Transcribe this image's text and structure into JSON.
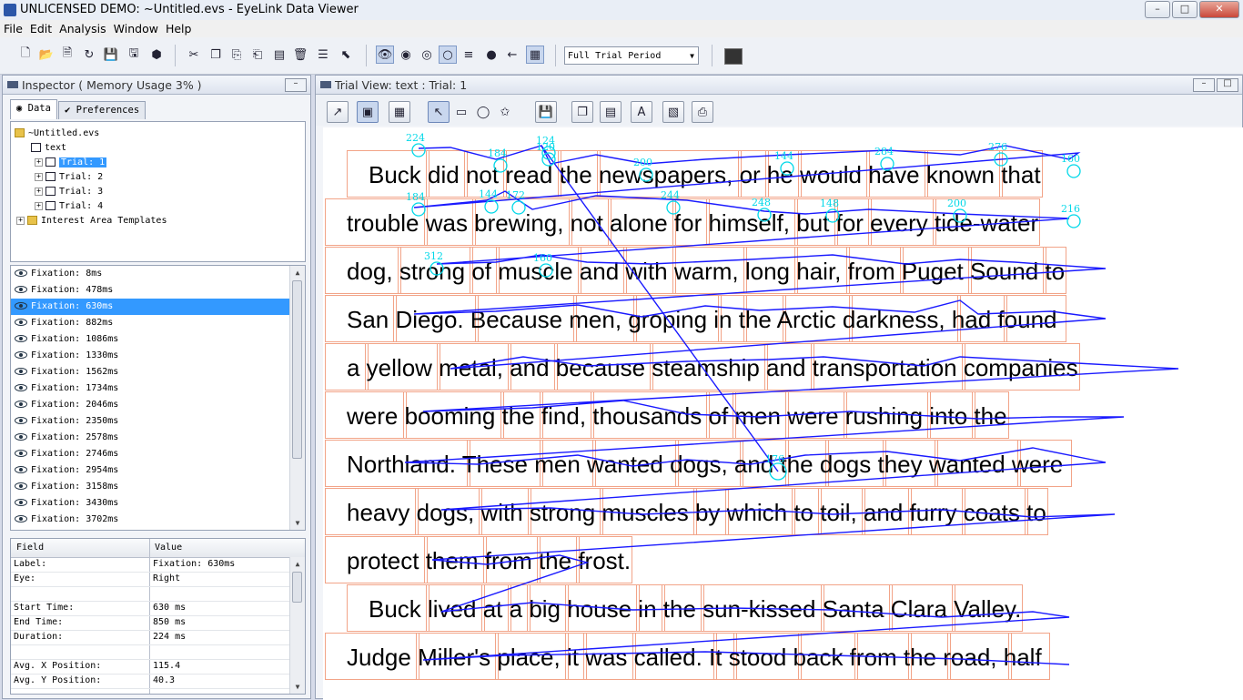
{
  "window": {
    "title": "UNLICENSED DEMO: ~Untitled.evs - EyeLink Data Viewer",
    "minimize": "–",
    "maximize": "□",
    "close": "✕"
  },
  "menu": [
    "File",
    "Edit",
    "Analysis",
    "Window",
    "Help"
  ],
  "toolbar": {
    "period_select": "Full Trial Period"
  },
  "inspector": {
    "title": "Inspector ( Memory Usage 3% )",
    "tabs": [
      "Data",
      "Preferences"
    ],
    "tree": {
      "root": "~Untitled.evs",
      "dataset": "text",
      "trials": [
        "Trial: 1",
        "Trial: 2",
        "Trial: 3",
        "Trial: 4"
      ],
      "templates": "Interest Area Templates"
    },
    "fixations": [
      "Fixation: 8ms",
      "Fixation: 478ms",
      "Fixation: 630ms",
      "Fixation: 882ms",
      "Fixation: 1086ms",
      "Fixation: 1330ms",
      "Fixation: 1562ms",
      "Fixation: 1734ms",
      "Fixation: 2046ms",
      "Fixation: 2350ms",
      "Fixation: 2578ms",
      "Fixation: 2746ms",
      "Fixation: 2954ms",
      "Fixation: 3158ms",
      "Fixation: 3430ms",
      "Fixation: 3702ms"
    ],
    "selected_fixation_index": 2,
    "properties": {
      "header_field": "Field",
      "header_value": "Value",
      "rows": [
        {
          "field": "Label:",
          "value": "Fixation: 630ms"
        },
        {
          "field": "Eye:",
          "value": "Right"
        },
        {
          "field": "",
          "value": ""
        },
        {
          "field": "Start Time:",
          "value": "630 ms"
        },
        {
          "field": "End Time:",
          "value": "850 ms"
        },
        {
          "field": "Duration:",
          "value": "224 ms"
        },
        {
          "field": "",
          "value": ""
        },
        {
          "field": "Avg. X Position:",
          "value": "115.4"
        },
        {
          "field": "Avg. Y Position:",
          "value": "40.3"
        }
      ]
    }
  },
  "trial_view": {
    "title": "Trial View: text : Trial: 1",
    "lines": [
      "Buck did not read the newspapers, or he would have known that",
      "trouble was brewing, not alone for himself, but for every tide-water",
      "dog, strong of muscle and with warm, long hair, from Puget Sound to",
      "San Diego.  Because men, groping in the Arctic darkness, had found",
      "a yellow metal, and because steamship and transportation companies",
      "were booming the find, thousands of men were rushing into the",
      "Northland.  These men wanted dogs, and the dogs they wanted were",
      "heavy dogs, with strong muscles by which to toil, and furry coats to",
      "protect them from the frost.",
      "Buck lived at a big house in the sun-kissed Santa Clara Valley.",
      "Judge Miller's place, it was called.  It stood back from the road, half"
    ],
    "fixation_labels": [
      "224",
      "184",
      "124",
      "120",
      "200",
      "144",
      "284",
      "276",
      "160",
      "184",
      "144",
      "172",
      "244",
      "248",
      "148",
      "200",
      "216",
      "312",
      "160",
      "176"
    ],
    "colors": {
      "interest_area": "#f2a488",
      "scanpath": "#1a1aff",
      "fixation_label": "#00d8e8"
    }
  }
}
